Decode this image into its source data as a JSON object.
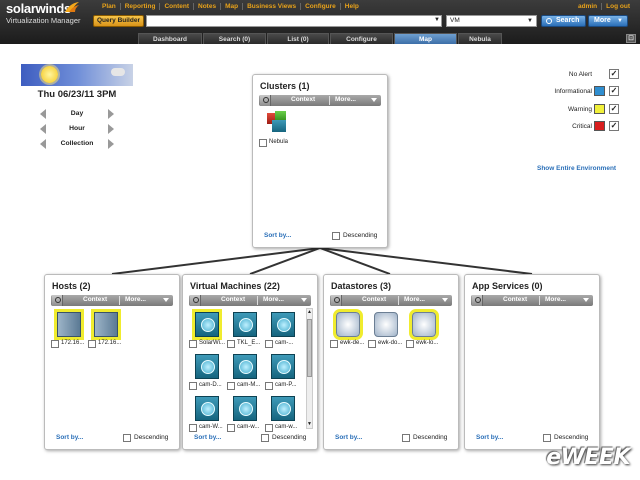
{
  "app": {
    "brand": "solarwinds",
    "product": "Virtualization Manager"
  },
  "menu": [
    "Plan",
    "Reporting",
    "Content",
    "Notes",
    "Map",
    "Business Views",
    "Configure",
    "Help"
  ],
  "user_links": [
    "admin",
    "Log out"
  ],
  "toolbar": {
    "query_builder": "Query Builder",
    "search_value": "",
    "scope_value": "VM",
    "search_button": "Search",
    "more_button": "More"
  },
  "tabs": [
    {
      "label": "Dashboard",
      "active": false
    },
    {
      "label": "Search (0)",
      "active": false
    },
    {
      "label": "List (0)",
      "active": false
    },
    {
      "label": "Configure",
      "active": false
    },
    {
      "label": "Map",
      "active": true
    },
    {
      "label": "Nebula",
      "active": false
    }
  ],
  "timeline": {
    "date": "Thu 06/23/11 3PM",
    "rows": [
      "Day",
      "Hour",
      "Collection"
    ]
  },
  "legend": [
    {
      "label": "No Alert",
      "color": "",
      "checked": "✓"
    },
    {
      "label": "Informational",
      "color": "#2f8ed0",
      "checked": "✓"
    },
    {
      "label": "Warning",
      "color": "#f1f03a",
      "checked": "✓"
    },
    {
      "label": "Critical",
      "color": "#d81e1e",
      "checked": "✓"
    }
  ],
  "show_environment": "Show Entire Environment",
  "panel_common": {
    "context": "Context",
    "more": "More...",
    "sort_by": "Sort by...",
    "descending": "Descending"
  },
  "clusters": {
    "title": "Clusters (1)",
    "items": [
      {
        "name": "Nebula"
      }
    ]
  },
  "hosts": {
    "title": "Hosts (2)",
    "items": [
      {
        "name": "172.16..."
      },
      {
        "name": "172.16..."
      }
    ]
  },
  "vms": {
    "title": "Virtual Machines (22)",
    "items": [
      {
        "name": "SolarWi..."
      },
      {
        "name": "TKL_E..."
      },
      {
        "name": "cam-..."
      },
      {
        "name": "cam-D..."
      },
      {
        "name": "cam-M..."
      },
      {
        "name": "cam-P..."
      },
      {
        "name": "cam-W..."
      },
      {
        "name": "cam-w..."
      },
      {
        "name": "cam-w..."
      }
    ]
  },
  "datastores": {
    "title": "Datastores (3)",
    "items": [
      {
        "name": "ewk-de..."
      },
      {
        "name": "ewk-do..."
      },
      {
        "name": "ewk-lo..."
      }
    ]
  },
  "app_services": {
    "title": "App Services (0)",
    "items": []
  },
  "watermark": "eWEEK"
}
